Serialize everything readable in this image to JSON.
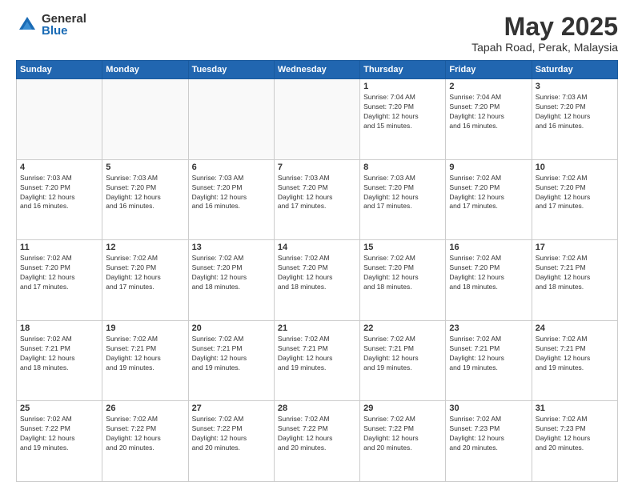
{
  "logo": {
    "general": "General",
    "blue": "Blue"
  },
  "header": {
    "month": "May 2025",
    "location": "Tapah Road, Perak, Malaysia"
  },
  "weekdays": [
    "Sunday",
    "Monday",
    "Tuesday",
    "Wednesday",
    "Thursday",
    "Friday",
    "Saturday"
  ],
  "weeks": [
    [
      {
        "day": "",
        "info": ""
      },
      {
        "day": "",
        "info": ""
      },
      {
        "day": "",
        "info": ""
      },
      {
        "day": "",
        "info": ""
      },
      {
        "day": "1",
        "info": "Sunrise: 7:04 AM\nSunset: 7:20 PM\nDaylight: 12 hours\nand 15 minutes."
      },
      {
        "day": "2",
        "info": "Sunrise: 7:04 AM\nSunset: 7:20 PM\nDaylight: 12 hours\nand 16 minutes."
      },
      {
        "day": "3",
        "info": "Sunrise: 7:03 AM\nSunset: 7:20 PM\nDaylight: 12 hours\nand 16 minutes."
      }
    ],
    [
      {
        "day": "4",
        "info": "Sunrise: 7:03 AM\nSunset: 7:20 PM\nDaylight: 12 hours\nand 16 minutes."
      },
      {
        "day": "5",
        "info": "Sunrise: 7:03 AM\nSunset: 7:20 PM\nDaylight: 12 hours\nand 16 minutes."
      },
      {
        "day": "6",
        "info": "Sunrise: 7:03 AM\nSunset: 7:20 PM\nDaylight: 12 hours\nand 16 minutes."
      },
      {
        "day": "7",
        "info": "Sunrise: 7:03 AM\nSunset: 7:20 PM\nDaylight: 12 hours\nand 17 minutes."
      },
      {
        "day": "8",
        "info": "Sunrise: 7:03 AM\nSunset: 7:20 PM\nDaylight: 12 hours\nand 17 minutes."
      },
      {
        "day": "9",
        "info": "Sunrise: 7:02 AM\nSunset: 7:20 PM\nDaylight: 12 hours\nand 17 minutes."
      },
      {
        "day": "10",
        "info": "Sunrise: 7:02 AM\nSunset: 7:20 PM\nDaylight: 12 hours\nand 17 minutes."
      }
    ],
    [
      {
        "day": "11",
        "info": "Sunrise: 7:02 AM\nSunset: 7:20 PM\nDaylight: 12 hours\nand 17 minutes."
      },
      {
        "day": "12",
        "info": "Sunrise: 7:02 AM\nSunset: 7:20 PM\nDaylight: 12 hours\nand 17 minutes."
      },
      {
        "day": "13",
        "info": "Sunrise: 7:02 AM\nSunset: 7:20 PM\nDaylight: 12 hours\nand 18 minutes."
      },
      {
        "day": "14",
        "info": "Sunrise: 7:02 AM\nSunset: 7:20 PM\nDaylight: 12 hours\nand 18 minutes."
      },
      {
        "day": "15",
        "info": "Sunrise: 7:02 AM\nSunset: 7:20 PM\nDaylight: 12 hours\nand 18 minutes."
      },
      {
        "day": "16",
        "info": "Sunrise: 7:02 AM\nSunset: 7:20 PM\nDaylight: 12 hours\nand 18 minutes."
      },
      {
        "day": "17",
        "info": "Sunrise: 7:02 AM\nSunset: 7:21 PM\nDaylight: 12 hours\nand 18 minutes."
      }
    ],
    [
      {
        "day": "18",
        "info": "Sunrise: 7:02 AM\nSunset: 7:21 PM\nDaylight: 12 hours\nand 18 minutes."
      },
      {
        "day": "19",
        "info": "Sunrise: 7:02 AM\nSunset: 7:21 PM\nDaylight: 12 hours\nand 19 minutes."
      },
      {
        "day": "20",
        "info": "Sunrise: 7:02 AM\nSunset: 7:21 PM\nDaylight: 12 hours\nand 19 minutes."
      },
      {
        "day": "21",
        "info": "Sunrise: 7:02 AM\nSunset: 7:21 PM\nDaylight: 12 hours\nand 19 minutes."
      },
      {
        "day": "22",
        "info": "Sunrise: 7:02 AM\nSunset: 7:21 PM\nDaylight: 12 hours\nand 19 minutes."
      },
      {
        "day": "23",
        "info": "Sunrise: 7:02 AM\nSunset: 7:21 PM\nDaylight: 12 hours\nand 19 minutes."
      },
      {
        "day": "24",
        "info": "Sunrise: 7:02 AM\nSunset: 7:21 PM\nDaylight: 12 hours\nand 19 minutes."
      }
    ],
    [
      {
        "day": "25",
        "info": "Sunrise: 7:02 AM\nSunset: 7:22 PM\nDaylight: 12 hours\nand 19 minutes."
      },
      {
        "day": "26",
        "info": "Sunrise: 7:02 AM\nSunset: 7:22 PM\nDaylight: 12 hours\nand 20 minutes."
      },
      {
        "day": "27",
        "info": "Sunrise: 7:02 AM\nSunset: 7:22 PM\nDaylight: 12 hours\nand 20 minutes."
      },
      {
        "day": "28",
        "info": "Sunrise: 7:02 AM\nSunset: 7:22 PM\nDaylight: 12 hours\nand 20 minutes."
      },
      {
        "day": "29",
        "info": "Sunrise: 7:02 AM\nSunset: 7:22 PM\nDaylight: 12 hours\nand 20 minutes."
      },
      {
        "day": "30",
        "info": "Sunrise: 7:02 AM\nSunset: 7:23 PM\nDaylight: 12 hours\nand 20 minutes."
      },
      {
        "day": "31",
        "info": "Sunrise: 7:02 AM\nSunset: 7:23 PM\nDaylight: 12 hours\nand 20 minutes."
      }
    ]
  ]
}
